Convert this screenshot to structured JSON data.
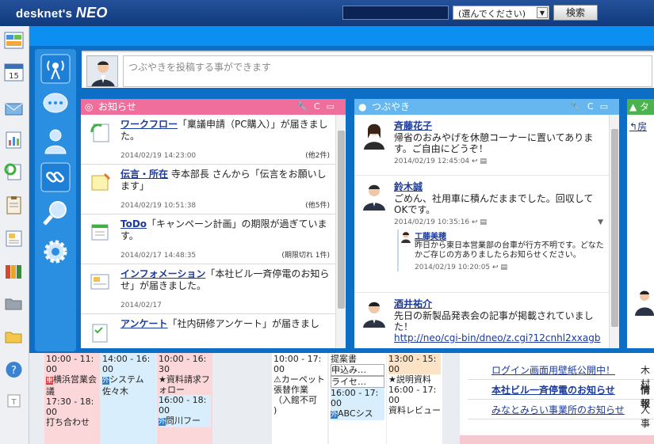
{
  "topbar": {
    "logo": "desknet's",
    "logo_neo": "NEO",
    "select_value": "(選んでください)",
    "search_label": "検索"
  },
  "post": {
    "placeholder": "つぶやきを投稿する事ができます"
  },
  "notice": {
    "title": "お知らせ",
    "items": [
      {
        "link": "ワークフロー",
        "text": "「稟議申請（PC購入）」が届きました。",
        "date": "2014/02/19 14:23:00",
        "count": "(他2件)"
      },
      {
        "link": "伝言・所在",
        "text": " 寺本部長 さんから「伝言をお願いします」",
        "date": "2014/02/19 10:51:38",
        "count": "(他5件)"
      },
      {
        "link": "ToDo",
        "text": "「キャンペーン計画」の期限が過ぎています。",
        "date": "2014/02/17 14:48:35",
        "count": "(期限切れ 1件)"
      },
      {
        "link": "インフォメーション",
        "text": "「本社ビル一斉停電のお知らせ」が届きました。",
        "date": "2014/02/17",
        "count": ""
      },
      {
        "link": "アンケート",
        "text": "「社内研修アンケート」が届きまし",
        "date": "",
        "count": ""
      }
    ]
  },
  "tweet": {
    "title": "つぶやき",
    "items": [
      {
        "name": "斉藤花子",
        "msg": "帰省のおみやげを休憩コーナーに置いてあります。ご自由にどうぞ！",
        "date": "2014/02/19 12:45:04"
      },
      {
        "name": "鈴木誠",
        "msg": "ごめん、社用車に積んだままでした。回収してOKです。",
        "date": "2014/02/19 10:35:16",
        "reply": {
          "name": "工藤美穂",
          "msg": "昨日から東日本営業部の台車が行方不明です。どなたかご存じの方ありましたらお知らせください。",
          "date": "2014/02/19 10:20:05"
        }
      },
      {
        "name": "酒井祐介",
        "msg": "先日の新製品発表会の記事が掲載されていました！",
        "link": "http://neo/cgi-bin/dneo/z.cgi?12cnhl2xxagb",
        "date": ""
      }
    ]
  },
  "third": {
    "title": "タ",
    "item": "房"
  },
  "calendar": {
    "c1": [
      "10:00 - 11:",
      "00",
      "横浜営業会議",
      "17:30 - 18:",
      "00",
      "打ち合わせ"
    ],
    "c2": [
      "14:00 - 16:",
      "00",
      "外",
      "システム佐々木"
    ],
    "c3": [
      "10:00 - 16:",
      "30",
      "資料請求フォロー",
      "16:00 - 18:",
      "00",
      "外",
      "問川フー"
    ],
    "c4": [
      "10:00 - 17:",
      "00",
      "カーペット張替作業",
      "（入館不可",
      ")"
    ],
    "c5": [
      "提案書",
      "申込み…",
      "ライセ…",
      "16:00 - 17:",
      "00",
      "外",
      "ABCシス"
    ],
    "c6": [
      "13:00 - 15:",
      "00",
      "説明資料",
      "16:00 - 17:",
      "00",
      "資料レビュー"
    ],
    "news": [
      {
        "title": "ログイン画面用壁紙公開中！",
        "who": "木村"
      },
      {
        "title": "本社ビル一斉停電のお知らせ",
        "who": "情報"
      },
      {
        "title": "みなとみらい事業所のお知らせ",
        "who": "人事"
      }
    ]
  },
  "colors": {
    "topbar": "#1a4a8f",
    "accent_blue": "#0b8ff1",
    "notice_header": "#f06e9c",
    "tweet_header": "#66b7ef",
    "third_header": "#4bb34b"
  }
}
